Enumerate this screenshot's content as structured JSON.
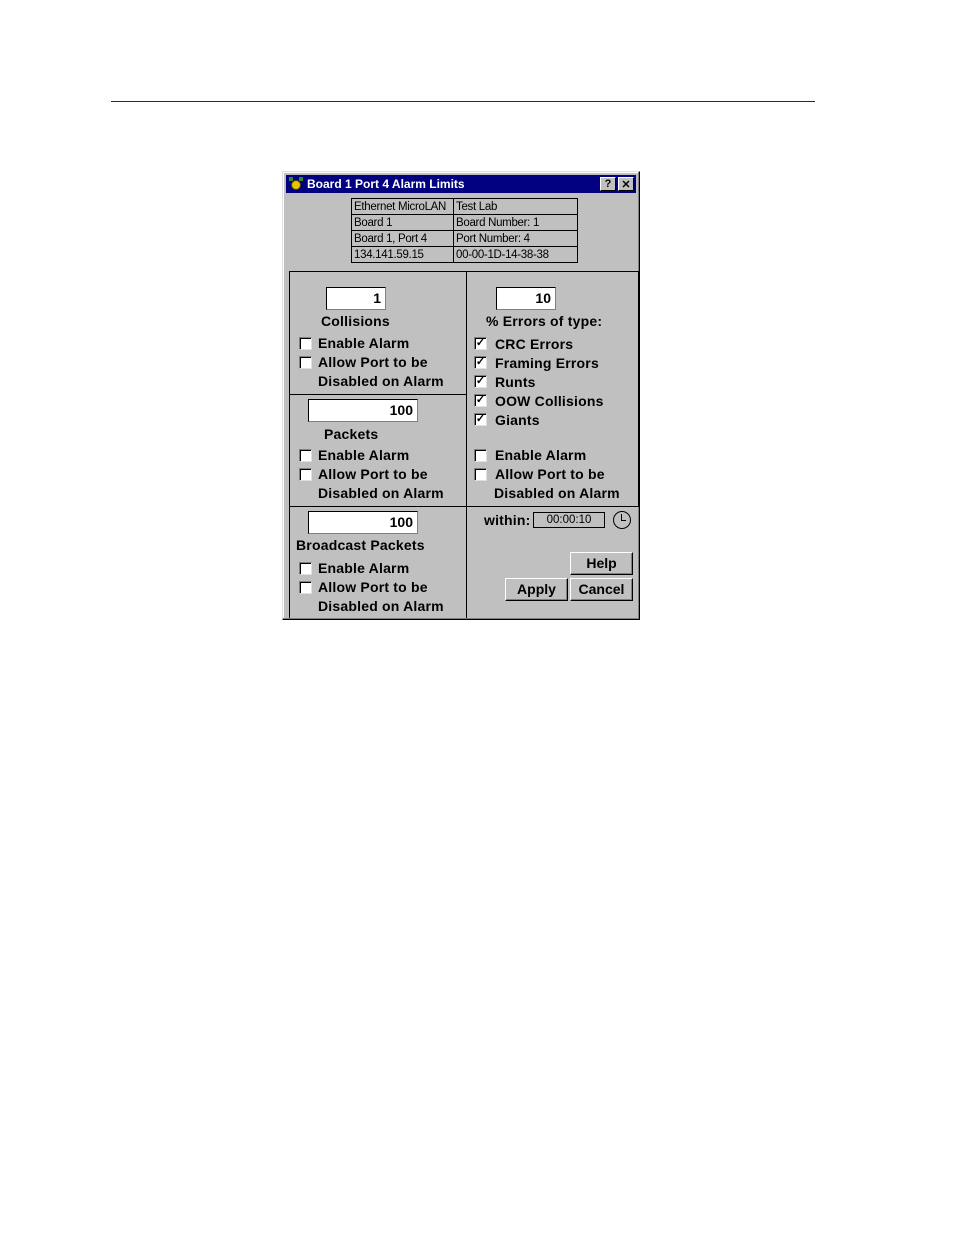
{
  "window": {
    "title": "Board 1 Port 4 Alarm Limits",
    "help_button": "?",
    "close_button": "✕"
  },
  "info_table": [
    [
      "Ethernet MicroLAN",
      "Test Lab"
    ],
    [
      "Board 1",
      "Board Number:  1"
    ],
    [
      "Board 1, Port 4",
      "Port Number:  4"
    ],
    [
      "134.141.59.15",
      "00-00-1D-14-38-38"
    ]
  ],
  "collisions": {
    "value": "1",
    "label": "Collisions",
    "enable_alarm": {
      "label": "Enable Alarm",
      "checked": false
    },
    "allow_disable": {
      "label_line1": "Allow Port to be",
      "label_line2": "Disabled on Alarm",
      "checked": false
    }
  },
  "packets": {
    "value": "100",
    "label": "Packets",
    "enable_alarm": {
      "label": "Enable Alarm",
      "checked": false
    },
    "allow_disable": {
      "label_line1": "Allow Port to be",
      "label_line2": "Disabled on Alarm",
      "checked": false
    }
  },
  "broadcast": {
    "value": "100",
    "label": "Broadcast Packets",
    "enable_alarm": {
      "label": "Enable Alarm",
      "checked": false
    },
    "allow_disable": {
      "label_line1": "Allow Port to be",
      "label_line2": "Disabled on Alarm",
      "checked": false
    }
  },
  "errors": {
    "value": "10",
    "label": "% Errors of type:",
    "types": [
      {
        "label": "CRC Errors",
        "checked": true
      },
      {
        "label": "Framing Errors",
        "checked": true
      },
      {
        "label": "Runts",
        "checked": true
      },
      {
        "label": "OOW Collisions",
        "checked": true
      },
      {
        "label": "Giants",
        "checked": true
      }
    ],
    "enable_alarm": {
      "label": "Enable Alarm",
      "checked": false
    },
    "allow_disable": {
      "label_line1": "Allow Port to be",
      "label_line2": "Disabled on Alarm",
      "checked": false
    }
  },
  "within": {
    "label": "within:",
    "value": "00:00:10"
  },
  "buttons": {
    "help": "Help",
    "apply": "Apply",
    "cancel": "Cancel"
  },
  "check_glyph": "✓"
}
